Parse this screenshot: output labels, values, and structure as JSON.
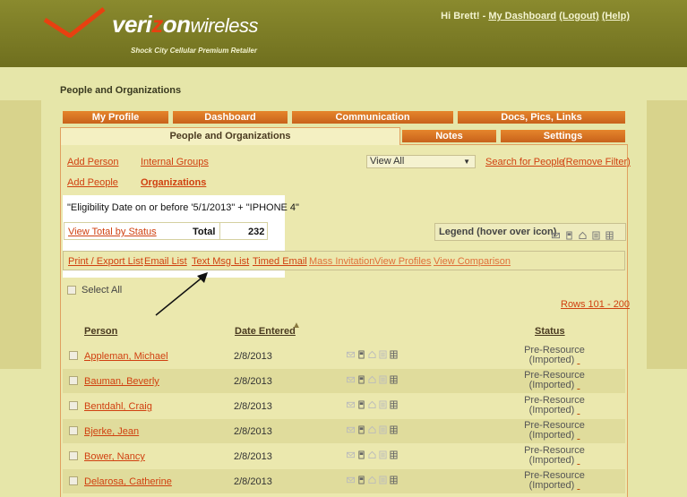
{
  "header": {
    "brand_strong": "veri",
    "brand_z": "z",
    "brand_on": "on",
    "brand_wireless": "wireless",
    "tagline": "Shock City Cellular Premium Retailer",
    "greeting": "Hi Brett! -",
    "dashboard_link": "My Dashboard",
    "logout_link": "(Logout)",
    "help_link": "(Help)"
  },
  "page_title": "People and Organizations",
  "tabs": {
    "my_profile": "My Profile",
    "dashboard": "Dashboard",
    "communication": "Communication",
    "docs": "Docs, Pics, Links",
    "people_orgs": "People and Organizations",
    "notes": "Notes",
    "settings": "Settings"
  },
  "links": {
    "add_person": "Add Person",
    "internal_groups": "Internal Groups",
    "add_people": "Add People",
    "organizations": "Organizations",
    "search_people": "Search for People",
    "remove_filter": "(Remove Filter)"
  },
  "filter": {
    "selected": "View All"
  },
  "criteria": "\"Eligibility Date on or before '5/1/2013\" + \"IPHONE 4\"",
  "stats": {
    "view_total": "View Total by Status",
    "total_label": "Total",
    "total_value": "232"
  },
  "legend": {
    "label": "Legend (hover over icon)"
  },
  "actions": {
    "print": "Print / Export List",
    "email": "Email List",
    "text": "Text Msg List",
    "timed_email": "Timed Email",
    "mass_invite": "Mass Invitation",
    "view_profiles": "View Profiles",
    "view_comparison": "View Comparison"
  },
  "select_all": "Select All",
  "rows_range": "Rows 101 - 200",
  "columns": {
    "person": "Person",
    "date": "Date Entered",
    "status": "Status"
  },
  "rows": [
    {
      "name": "Appleman, Michael",
      "date": "2/8/2013",
      "status1": "Pre-Resource",
      "status2": "(Imported)"
    },
    {
      "name": "Bauman, Beverly",
      "date": "2/8/2013",
      "status1": "Pre-Resource",
      "status2": "(Imported)"
    },
    {
      "name": "Bentdahl, Craig",
      "date": "2/8/2013",
      "status1": "Pre-Resource",
      "status2": "(Imported)"
    },
    {
      "name": "Bjerke, Jean",
      "date": "2/8/2013",
      "status1": "Pre-Resource",
      "status2": "(Imported)"
    },
    {
      "name": "Bower, Nancy",
      "date": "2/8/2013",
      "status1": "Pre-Resource",
      "status2": "(Imported)"
    },
    {
      "name": "Delarosa, Catherine",
      "date": "2/8/2013",
      "status1": "Pre-Resource",
      "status2": "(Imported)"
    }
  ],
  "colors": {
    "accent": "#d04010",
    "tab": "#d8721f",
    "header": "#7a7a26",
    "bg": "#e6e6a9"
  }
}
